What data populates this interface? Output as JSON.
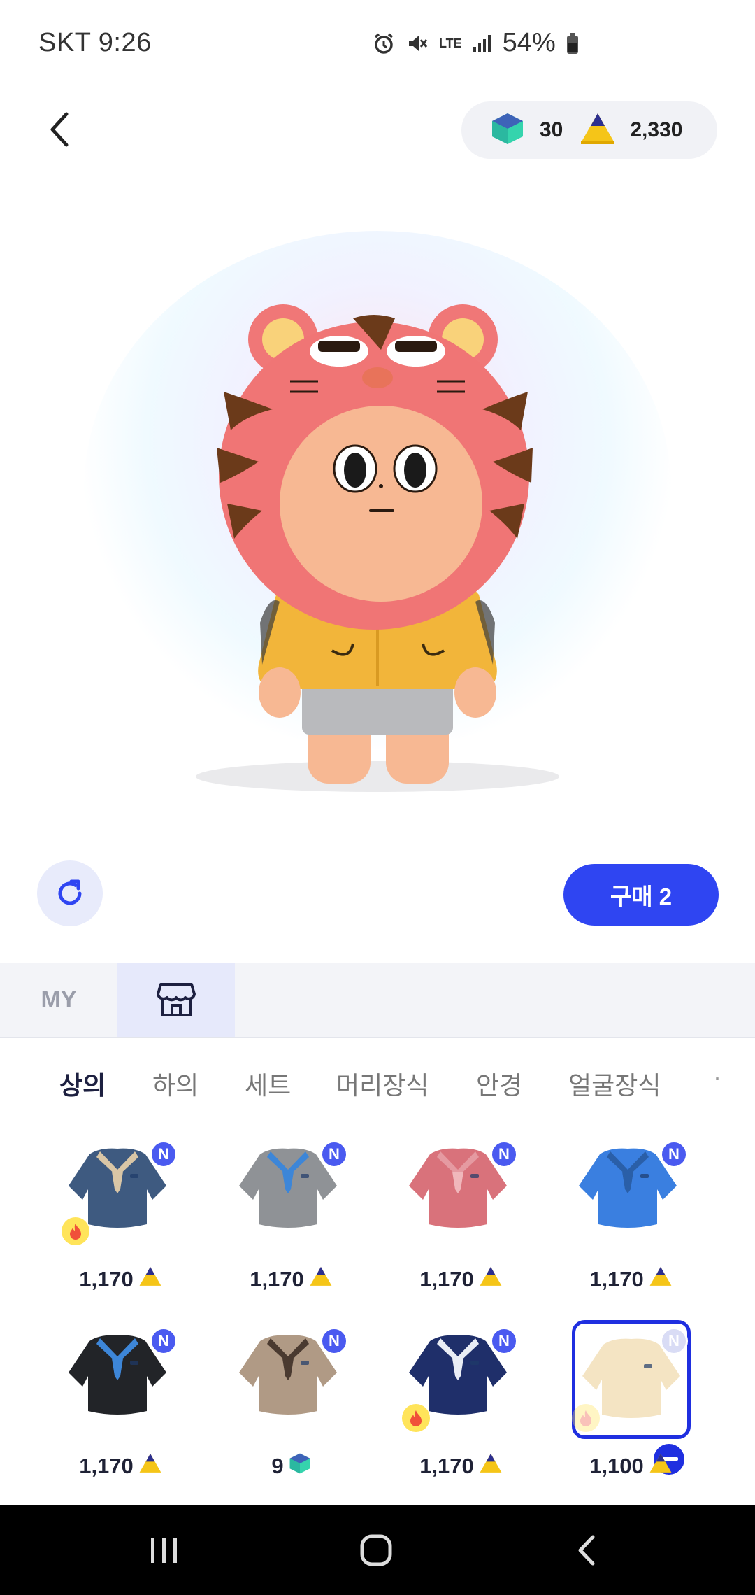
{
  "status": {
    "carrier_time": "SKT 9:26",
    "network": "LTE",
    "battery": "54%"
  },
  "wallet": {
    "gems": "30",
    "coins": "2,330"
  },
  "actions": {
    "buy_label": "구매 2"
  },
  "mode_tabs": {
    "my_label": "MY",
    "shop_icon": "shop-icon"
  },
  "categories": [
    "상의",
    "하의",
    "세트",
    "머리장식",
    "안경",
    "얼굴장식"
  ],
  "active_category": "상의",
  "items": [
    {
      "price": "1,170",
      "currency": "coin",
      "new": "N",
      "hot": true,
      "color": "#3e5a80",
      "collar": "#d9c6a6",
      "tie": "#d9c6a6"
    },
    {
      "price": "1,170",
      "currency": "coin",
      "new": "N",
      "hot": false,
      "color": "#8f9296",
      "collar": "#3d86d8",
      "tie": "#3d86d8"
    },
    {
      "price": "1,170",
      "currency": "coin",
      "new": "N",
      "hot": false,
      "color": "#d9727b",
      "collar": "#e59aa1",
      "tie": "#f0b7bb"
    },
    {
      "price": "1,170",
      "currency": "coin",
      "new": "N",
      "hot": false,
      "color": "#3a7fe0",
      "collar": "#2a5fa8",
      "tie": "#2a5fa8"
    },
    {
      "price": "1,170",
      "currency": "coin",
      "new": "N",
      "hot": false,
      "color": "#222428",
      "collar": "#3d86d8",
      "tie": "#3d86d8"
    },
    {
      "price": "9",
      "currency": "gem",
      "new": "N",
      "hot": false,
      "color": "#b09a85",
      "collar": "#4a3a30",
      "tie": "#4a3a30"
    },
    {
      "price": "1,170",
      "currency": "coin",
      "new": "N",
      "hot": true,
      "color": "#1f2f6a",
      "collar": "#e9edf5",
      "tie": "#e9edf5"
    },
    {
      "price": "1,100",
      "currency": "coin",
      "new": "N",
      "hot": true,
      "color": "#f4e4c3",
      "collar": "#f4e4c3",
      "tie": "#f4e4c3",
      "selected": true
    }
  ],
  "colors": {
    "accent": "#2f45f2",
    "badge": "#4a5af0",
    "coin": "#f7c31a",
    "gem": "#3ad4b0"
  }
}
